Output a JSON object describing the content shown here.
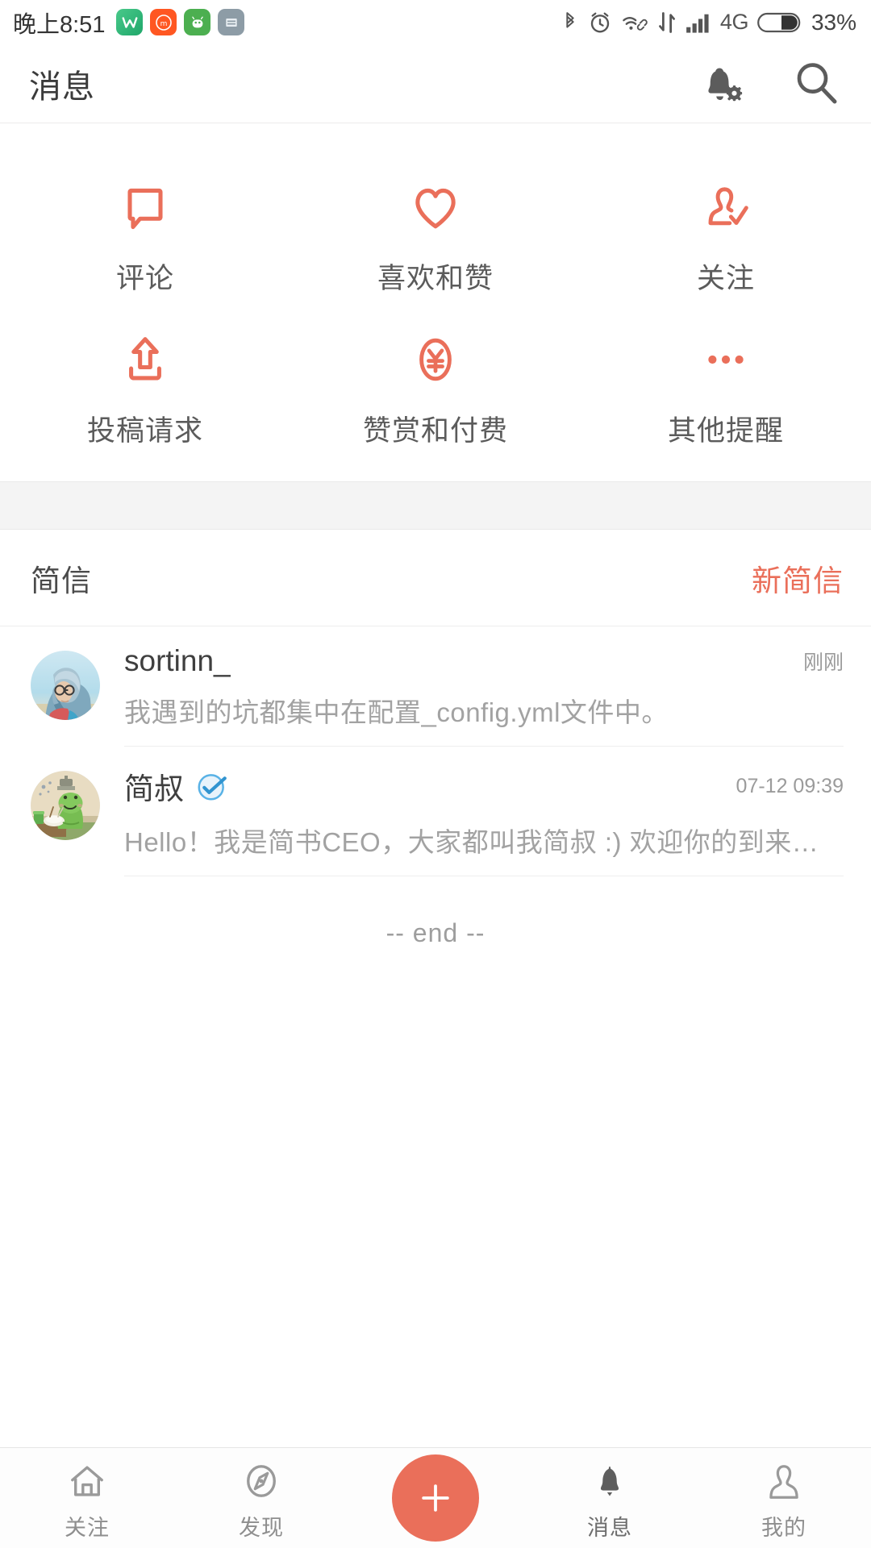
{
  "theme": {
    "accent": "#ea6f5a",
    "text_dark": "#3b3b3b",
    "text_muted": "#9e9e9e",
    "verified_blue": "#3194d0",
    "tab_icon": "#9a9a9a",
    "tab_icon_active": "#5e5e5e"
  },
  "status_bar": {
    "time": "晚上8:51",
    "app_icons": [
      "wallet-app-icon",
      "mi-app-icon",
      "android-app-icon",
      "file-app-icon"
    ],
    "indicators": [
      "bluetooth-icon",
      "alarm-icon",
      "wifi-icon",
      "data-transfer-icon",
      "signal-bars-icon"
    ],
    "network": "4G",
    "battery_percent": "33%"
  },
  "header": {
    "title": "消息",
    "actions": [
      {
        "name": "notification-settings-icon",
        "label": "通知设置"
      },
      {
        "name": "search-icon",
        "label": "搜索"
      }
    ]
  },
  "grid": {
    "rows": [
      [
        {
          "icon": "comment-icon",
          "label": "评论"
        },
        {
          "icon": "heart-icon",
          "label": "喜欢和赞"
        },
        {
          "icon": "follow-user-icon",
          "label": "关注"
        }
      ],
      [
        {
          "icon": "upload-submission-icon",
          "label": "投稿请求"
        },
        {
          "icon": "yen-reward-icon",
          "label": "赞赏和付费"
        },
        {
          "icon": "ellipsis-icon",
          "label": "其他提醒"
        }
      ]
    ]
  },
  "letters": {
    "section_title": "简信",
    "new_letter_label": "新简信",
    "items": [
      {
        "avatar": "avatar-photo-hoodie",
        "name": "sortinn_",
        "verified": false,
        "time": "刚刚",
        "preview": "我遇到的坑都集中在配置_config.yml文件中。"
      },
      {
        "avatar": "avatar-frog-illustration",
        "name": "简叔",
        "verified": true,
        "time": "07-12 09:39",
        "preview": "Hello！我是简书CEO，大家都叫我简叔 :) 欢迎你的到来，成…"
      }
    ],
    "end_marker": "-- end --"
  },
  "tabbar": {
    "items": [
      {
        "icon": "home-icon",
        "label": "关注",
        "active": false
      },
      {
        "icon": "compass-icon",
        "label": "发现",
        "active": false
      },
      {
        "icon": "plus-icon",
        "label": "",
        "active": false
      },
      {
        "icon": "bell-icon",
        "label": "消息",
        "active": true
      },
      {
        "icon": "person-icon",
        "label": "我的",
        "active": false
      }
    ]
  }
}
